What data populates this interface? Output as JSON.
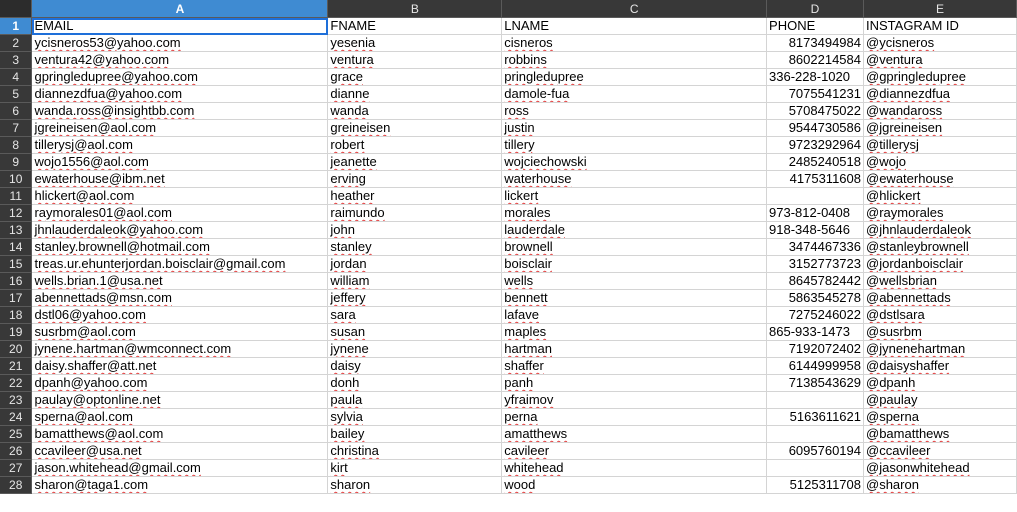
{
  "columns": [
    "A",
    "B",
    "C",
    "D",
    "E"
  ],
  "rows": [
    {
      "n": "1",
      "a": "EMAIL",
      "b": "FNAME",
      "c": "LNAME",
      "d": "PHONE",
      "e": "INSTAGRAM ID"
    },
    {
      "n": "2",
      "a": "ycisneros53@yahoo.com",
      "b": "yesenia",
      "c": "cisneros",
      "d": "8173494984",
      "e": "@ycisneros"
    },
    {
      "n": "3",
      "a": "ventura42@yahoo.com",
      "b": "ventura",
      "c": "robbins",
      "d": "8602214584",
      "e": "@ventura"
    },
    {
      "n": "4",
      "a": "gpringledupree@yahoo.com",
      "b": "grace",
      "c": "pringledupree",
      "d": "336-228-1020",
      "e": "@gpringledupree"
    },
    {
      "n": "5",
      "a": "diannezdfua@yahoo.com",
      "b": "dianne",
      "c": "damole-fua",
      "d": "7075541231",
      "e": "@diannezdfua"
    },
    {
      "n": "6",
      "a": "wanda.ross@insightbb.com",
      "b": "wanda",
      "c": "ross",
      "d": "5708475022",
      "e": "@wandaross"
    },
    {
      "n": "7",
      "a": "jgreineisen@aol.com",
      "b": "greineisen",
      "c": "justin",
      "d": "9544730586",
      "e": "@jgreineisen"
    },
    {
      "n": "8",
      "a": "tillerysj@aol.com",
      "b": "robert",
      "c": "tillery",
      "d": "9723292964",
      "e": "@tillerysj"
    },
    {
      "n": "9",
      "a": "wojo1556@aol.com",
      "b": "jeanette",
      "c": "wojciechowski",
      "d": "2485240518",
      "e": "@wojo"
    },
    {
      "n": "10",
      "a": "ewaterhouse@ibm.net",
      "b": "erving",
      "c": "waterhouse",
      "d": "4175311608",
      "e": "@ewaterhouse"
    },
    {
      "n": "11",
      "a": "hlickert@aol.com",
      "b": "heather",
      "c": "lickert",
      "d": "",
      "e": "@hlickert"
    },
    {
      "n": "12",
      "a": "raymorales01@aol.com",
      "b": "raimundo",
      "c": "morales",
      "d": "973-812-0408",
      "e": "@raymorales"
    },
    {
      "n": "13",
      "a": "jhnlauderdaleok@yahoo.com",
      "b": "john",
      "c": "lauderdale",
      "d": "918-348-5646",
      "e": "@jhnlauderdaleok"
    },
    {
      "n": "14",
      "a": "stanley.brownell@hotmail.com",
      "b": "stanley",
      "c": "brownell",
      "d": "3474467336",
      "e": "@stanleybrownell"
    },
    {
      "n": "15",
      "a": "treas.ur.ehunterjordan.boisclair@gmail.com",
      "b": "jordan",
      "c": "boisclair",
      "d": "3152773723",
      "e": "@jordanboisclair"
    },
    {
      "n": "16",
      "a": "wells.brian.1@usa.net",
      "b": "william",
      "c": "wells",
      "d": "8645782442",
      "e": "@wellsbrian"
    },
    {
      "n": "17",
      "a": "abennettads@msn.com",
      "b": "jeffery",
      "c": "bennett",
      "d": "5863545278",
      "e": "@abennettads"
    },
    {
      "n": "18",
      "a": "dstl06@yahoo.com",
      "b": "sara",
      "c": "lafave",
      "d": "7275246022",
      "e": "@dstlsara"
    },
    {
      "n": "19",
      "a": "susrbm@aol.com",
      "b": "susan",
      "c": "maples",
      "d": "865-933-1473",
      "e": "@susrbm"
    },
    {
      "n": "20",
      "a": "jynene.hartman@wmconnect.com",
      "b": "jynene",
      "c": "hartman",
      "d": "7192072402",
      "e": "@jynenehartman"
    },
    {
      "n": "21",
      "a": "daisy.shaffer@att.net",
      "b": "daisy",
      "c": "shaffer",
      "d": "6144999958",
      "e": "@daisyshaffer"
    },
    {
      "n": "22",
      "a": "dpanh@yahoo.com",
      "b": "donh",
      "c": "panh",
      "d": "7138543629",
      "e": "@dpanh"
    },
    {
      "n": "23",
      "a": "paulay@optonline.net",
      "b": "paula",
      "c": "yfraimov",
      "d": "",
      "e": "@paulay"
    },
    {
      "n": "24",
      "a": "sperna@aol.com",
      "b": "sylvia",
      "c": "perna",
      "d": "5163611621",
      "e": "@sperna"
    },
    {
      "n": "25",
      "a": "bamatthews@aol.com",
      "b": "bailey",
      "c": "amatthews",
      "d": "",
      "e": "@bamatthews"
    },
    {
      "n": "26",
      "a": "ccavileer@usa.net",
      "b": "christina",
      "c": "cavileer",
      "d": "6095760194",
      "e": "@ccavileer"
    },
    {
      "n": "27",
      "a": "jason.whitehead@gmail.com",
      "b": "kirt",
      "c": "whitehead",
      "d": "",
      "e": "@jasonwhitehead"
    },
    {
      "n": "28",
      "a": "sharon@taga1.com",
      "b": "sharon",
      "c": "wood",
      "d": "5125311708",
      "e": "@sharon"
    }
  ]
}
